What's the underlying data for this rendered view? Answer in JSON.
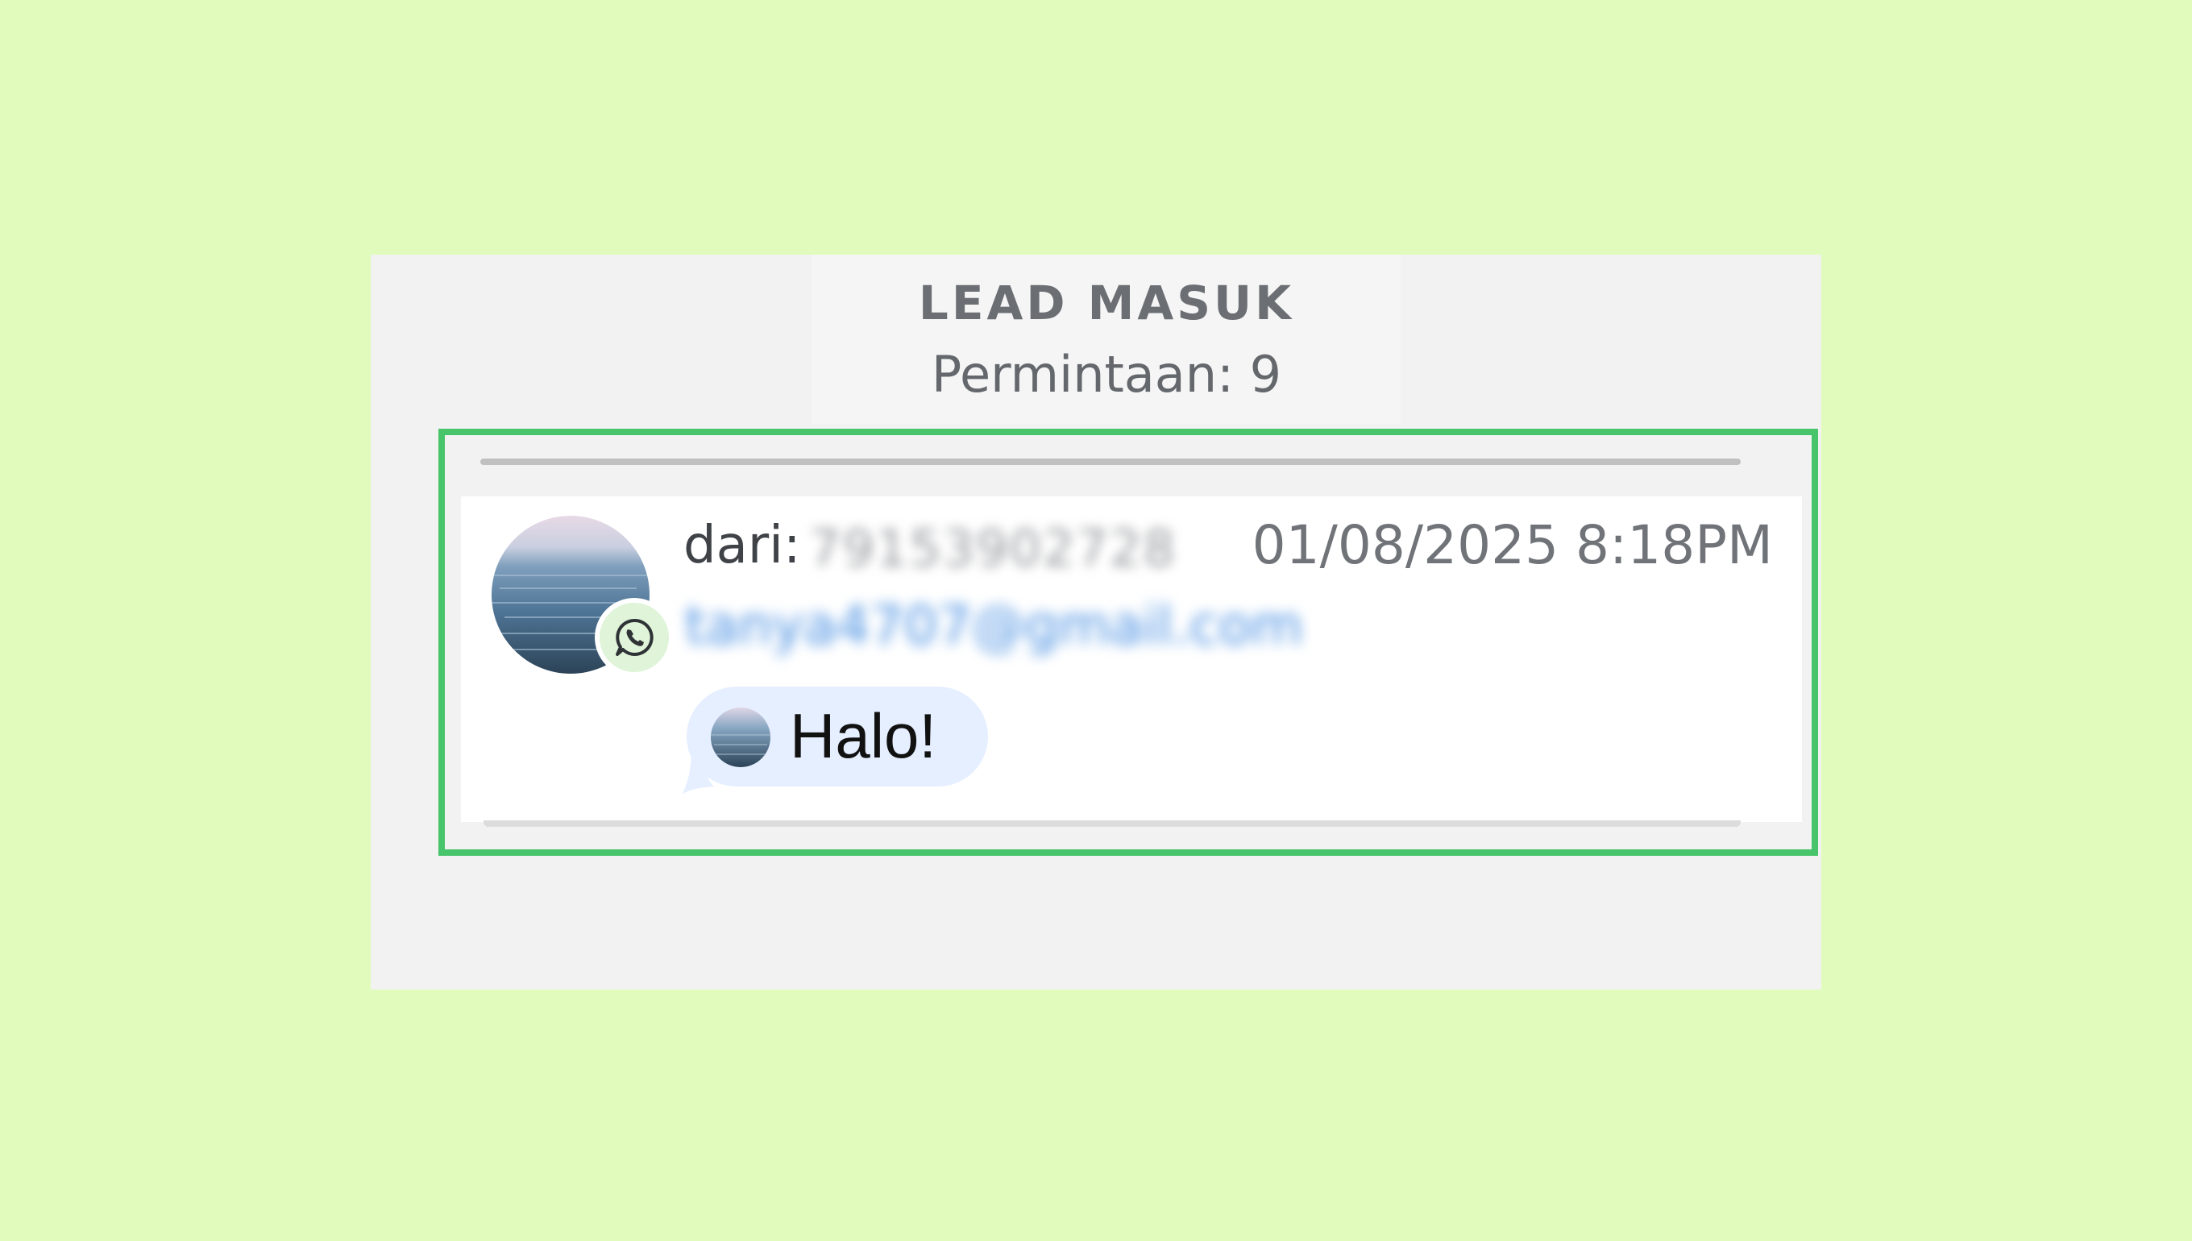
{
  "panel": {
    "title": "LEAD MASUK",
    "subtitle": "Permintaan: 9"
  },
  "lead": {
    "from_label": "dari:",
    "from_number": "79153902728",
    "timestamp": "01/08/2025 8:18PM",
    "email": "tanya4707@gmail.com",
    "message": "Halo!",
    "channel_icon": "whatsapp-icon",
    "avatar": "sea-photo-avatar"
  },
  "colors": {
    "page_background": "#e1fbbc",
    "highlight_border": "#48c46a",
    "bubble_background": "#e6efff",
    "email_link": "#4a90e2"
  }
}
